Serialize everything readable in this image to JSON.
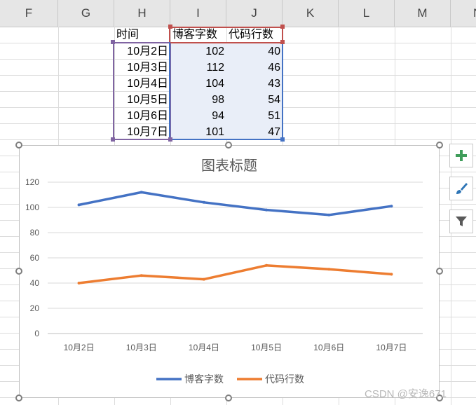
{
  "columns": [
    "F",
    "G",
    "H",
    "I",
    "J",
    "K",
    "L",
    "M",
    "N"
  ],
  "table": {
    "headers": [
      "时间",
      "博客字数",
      "代码行数"
    ],
    "rows": [
      {
        "date": "10月2日",
        "blog": "102",
        "code": "40"
      },
      {
        "date": "10月3日",
        "blog": "112",
        "code": "46"
      },
      {
        "date": "10月4日",
        "blog": "104",
        "code": "43"
      },
      {
        "date": "10月5日",
        "blog": "98",
        "code": "54"
      },
      {
        "date": "10月6日",
        "blog": "94",
        "code": "51"
      },
      {
        "date": "10月7日",
        "blog": "101",
        "code": "47"
      }
    ]
  },
  "chart_data": {
    "type": "line",
    "title": "图表标题",
    "categories": [
      "10月2日",
      "10月3日",
      "10月4日",
      "10月5日",
      "10月6日",
      "10月7日"
    ],
    "series": [
      {
        "name": "博客字数",
        "values": [
          102,
          112,
          104,
          98,
          94,
          101
        ],
        "color": "#4472c4"
      },
      {
        "name": "代码行数",
        "values": [
          40,
          46,
          43,
          54,
          51,
          47
        ],
        "color": "#ed7d31"
      }
    ],
    "yticks": [
      "0",
      "20",
      "40",
      "60",
      "80",
      "100",
      "120"
    ],
    "ylim": [
      0,
      120
    ],
    "grid": true,
    "legend": "bottom"
  },
  "side_buttons": {
    "add": "plus-icon",
    "style": "brush-icon",
    "filter": "filter-icon"
  },
  "watermark": "CSDN @安逸671"
}
